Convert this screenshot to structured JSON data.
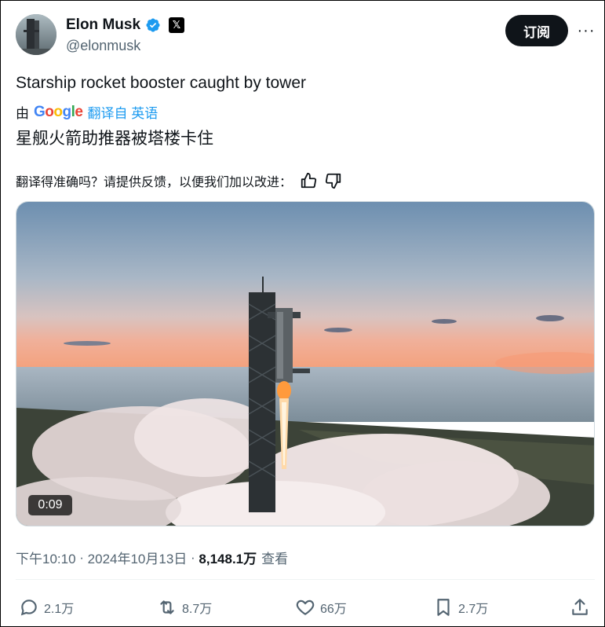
{
  "author": {
    "name": "Elon Musk",
    "handle": "@elonmusk",
    "verified_icon": "verified-badge-icon",
    "affiliation_icon": "x-logo-icon"
  },
  "header": {
    "subscribe_label": "订阅",
    "more_label": "···"
  },
  "tweet": {
    "text": "Starship rocket booster caught by tower",
    "translation_prefix": "由",
    "translation_provider": [
      "G",
      "o",
      "o",
      "g",
      "l",
      "e"
    ],
    "translation_link": "翻译自 英语",
    "translated_text": "星舰火箭助推器被塔楼卡住",
    "feedback_prompt": "翻译得准确吗？请提供反馈，以便我们加以改进："
  },
  "media": {
    "duration": "0:09"
  },
  "meta": {
    "time": "下午10:10",
    "sep": " · ",
    "date": "2024年10月13日",
    "sep2": " · ",
    "views_count": "8,148.1万",
    "views_label": "查看"
  },
  "actions": {
    "reply_count": "2.1万",
    "retweet_count": "8.7万",
    "like_count": "66万",
    "bookmark_count": "2.7万"
  },
  "colors": {
    "accent": "#1d9bf0",
    "text": "#0f1419",
    "muted": "#536471"
  }
}
